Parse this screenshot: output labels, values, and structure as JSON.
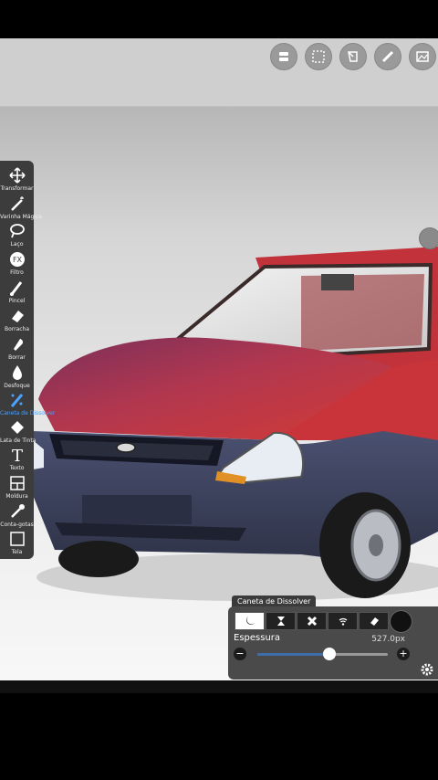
{
  "top_toolbar": {
    "icons": [
      "layers-icon",
      "selection-icon",
      "adjust-icon",
      "ruler-icon",
      "gallery-icon"
    ]
  },
  "left_toolbar": {
    "tools": [
      {
        "label": "Transformar",
        "icon": "move-icon"
      },
      {
        "label": "Varinha Mágica",
        "icon": "magic-wand-icon"
      },
      {
        "label": "Laço",
        "icon": "lasso-icon"
      },
      {
        "label": "Filtro",
        "icon": "fx-icon"
      },
      {
        "label": "Pincel",
        "icon": "brush-icon"
      },
      {
        "label": "Borracha",
        "icon": "eraser-icon"
      },
      {
        "label": "Borrar",
        "icon": "smudge-icon"
      },
      {
        "label": "Desfoque",
        "icon": "blur-icon"
      },
      {
        "label": "Caneta de Dissolver",
        "icon": "dissolve-pen-icon",
        "active": true
      },
      {
        "label": "Lata de Tinta",
        "icon": "bucket-icon"
      },
      {
        "label": "Texto",
        "icon": "text-icon"
      },
      {
        "label": "Moldura",
        "icon": "frame-icon"
      },
      {
        "label": "Conta-gotas",
        "icon": "eyedropper-icon"
      },
      {
        "label": "Tela",
        "icon": "canvas-icon"
      }
    ]
  },
  "brush_panel": {
    "title": "Caneta de Dissolver",
    "size_label": "Espessura",
    "size_value": "527.0px",
    "size_fraction": 0.55,
    "minus": "−",
    "plus": "+"
  },
  "colors": {
    "accent": "#3f6da9",
    "toolbar": "#3c3c3c",
    "car_red": "#c2323b",
    "bumper_blue": "#3e4460"
  }
}
